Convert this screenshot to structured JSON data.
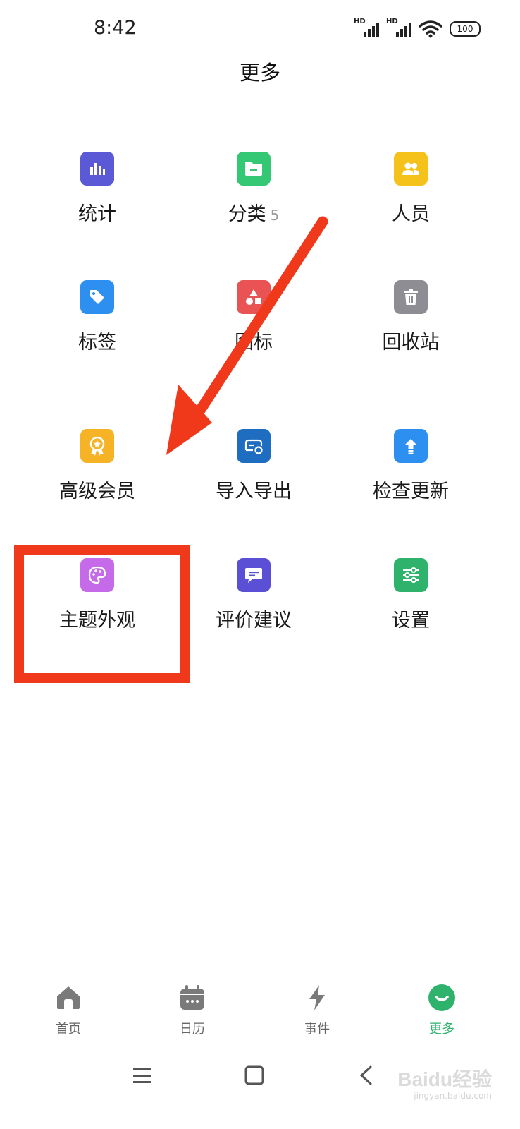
{
  "status_bar": {
    "time": "8:42",
    "signal1_label": "HD",
    "signal2_label": "HD",
    "battery": "100"
  },
  "header": {
    "title": "更多"
  },
  "grid": [
    {
      "label": "统计",
      "icon": "bar-chart-icon",
      "color": "#5b59d6"
    },
    {
      "label": "分类",
      "badge": "5",
      "icon": "folder-icon",
      "color": "#34c774"
    },
    {
      "label": "人员",
      "icon": "people-icon",
      "color": "#f5c21b"
    },
    {
      "label": "标签",
      "icon": "tag-icon",
      "color": "#2d8ff0"
    },
    {
      "label": "图标",
      "icon": "shapes-icon",
      "color": "#ea5353"
    },
    {
      "label": "回收站",
      "icon": "trash-icon",
      "color": "#8d8d93"
    },
    {
      "label": "高级会员",
      "icon": "award-icon",
      "color": "#f5b325"
    },
    {
      "label": "导入导出",
      "icon": "import-export-icon",
      "color": "#1f6dc0"
    },
    {
      "label": "检查更新",
      "icon": "upload-arrow-icon",
      "color": "#2d8ff0"
    },
    {
      "label": "主题外观",
      "icon": "palette-icon",
      "color": "#c56ae8"
    },
    {
      "label": "评价建议",
      "icon": "chat-icon",
      "color": "#5b4fd6"
    },
    {
      "label": "设置",
      "icon": "sliders-icon",
      "color": "#2fb36c"
    }
  ],
  "tabs": [
    {
      "label": "首页",
      "icon": "home-icon",
      "active": false
    },
    {
      "label": "日历",
      "icon": "calendar-icon",
      "active": false
    },
    {
      "label": "事件",
      "icon": "lightning-icon",
      "active": false
    },
    {
      "label": "更多",
      "icon": "smile-icon",
      "active": true
    }
  ],
  "colors": {
    "accent": "#2fb36c",
    "annotation": "#f0381a"
  },
  "watermark": {
    "text": "Baidu经验",
    "sub": "jingyan.baidu.com"
  }
}
